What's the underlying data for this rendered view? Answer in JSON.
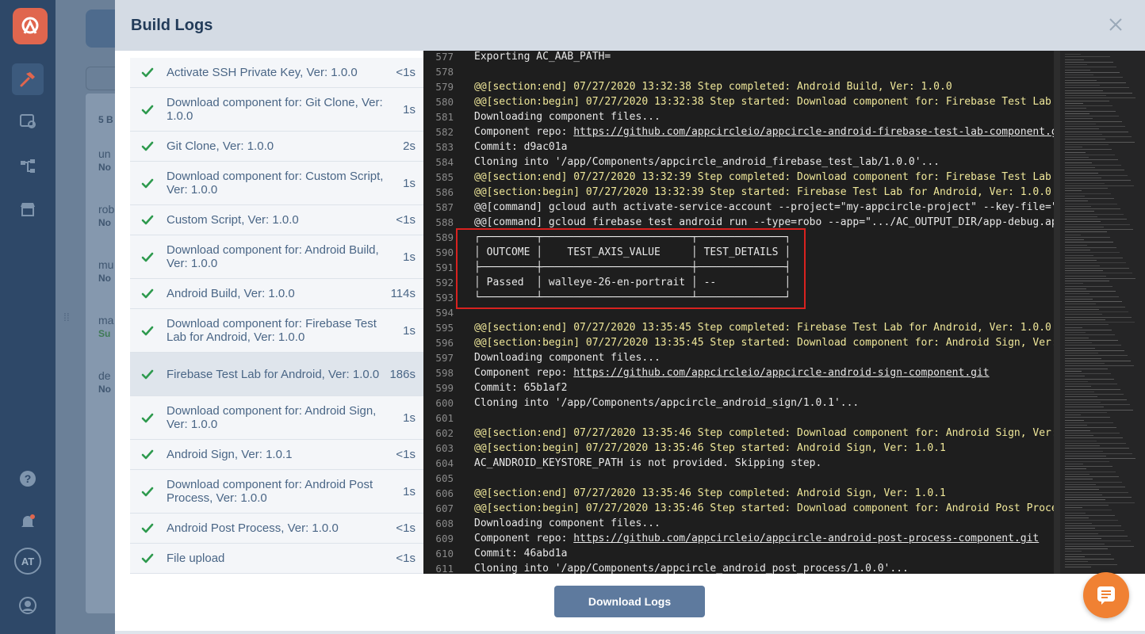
{
  "modal": {
    "title": "Build Logs",
    "download_label": "Download Logs"
  },
  "nav": {
    "avatar_initials": "AT"
  },
  "background": {
    "count_label": "5 B",
    "rows": [
      {
        "name": "un",
        "sub": "No"
      },
      {
        "name": "rob",
        "sub": "No"
      },
      {
        "name": "mu",
        "sub": "No"
      },
      {
        "name": "ma",
        "sub": "Su"
      },
      {
        "name": "de",
        "sub": "No"
      }
    ]
  },
  "steps": [
    {
      "label": "Activate SSH Private Key, Ver: 1.0.0",
      "duration": "<1s",
      "status": "success"
    },
    {
      "label": "Download component for: Git Clone, Ver: 1.0.0",
      "duration": "1s",
      "status": "success"
    },
    {
      "label": "Git Clone, Ver: 1.0.0",
      "duration": "2s",
      "status": "success"
    },
    {
      "label": "Download component for: Custom Script, Ver: 1.0.0",
      "duration": "1s",
      "status": "success"
    },
    {
      "label": "Custom Script, Ver: 1.0.0",
      "duration": "<1s",
      "status": "success"
    },
    {
      "label": "Download component for: Android Build, Ver: 1.0.0",
      "duration": "1s",
      "status": "success"
    },
    {
      "label": "Android Build, Ver: 1.0.0",
      "duration": "114s",
      "status": "success"
    },
    {
      "label": "Download component for: Firebase Test Lab for Android, Ver: 1.0.0",
      "duration": "1s",
      "status": "success"
    },
    {
      "label": "Firebase Test Lab for Android, Ver: 1.0.0",
      "duration": "186s",
      "status": "success",
      "selected": true
    },
    {
      "label": "Download component for: Android Sign, Ver: 1.0.0",
      "duration": "1s",
      "status": "success"
    },
    {
      "label": "Android Sign, Ver: 1.0.1",
      "duration": "<1s",
      "status": "success"
    },
    {
      "label": "Download component for: Android Post Process, Ver: 1.0.0",
      "duration": "1s",
      "status": "success"
    },
    {
      "label": "Android Post Process, Ver: 1.0.0",
      "duration": "<1s",
      "status": "success"
    },
    {
      "label": "File upload",
      "duration": "<1s",
      "status": "success"
    }
  ],
  "log_lines": [
    {
      "num": "577",
      "text": "Exporting AC_AAB_PATH="
    },
    {
      "num": "578",
      "text": ""
    },
    {
      "num": "579",
      "text": "@@[section:end] 07/27/2020 13:32:38 Step completed: Android Build, Ver: 1.0.0",
      "kind": "section"
    },
    {
      "num": "580",
      "text": "@@[section:begin] 07/27/2020 13:32:38 Step started: Download component for: Firebase Test Lab f",
      "kind": "section"
    },
    {
      "num": "581",
      "text": "Downloading component files..."
    },
    {
      "num": "582",
      "text": "Component repo: ",
      "link": "https://github.com/appcircleio/appcircle-android-firebase-test-lab-component.git"
    },
    {
      "num": "583",
      "text": "Commit: d9ac01a"
    },
    {
      "num": "584",
      "text": "Cloning into '/app/Components/appcircle_android_firebase_test_lab/1.0.0'..."
    },
    {
      "num": "585",
      "text": "@@[section:end] 07/27/2020 13:32:39 Step completed: Download component for: Firebase Test Lab f",
      "kind": "section"
    },
    {
      "num": "586",
      "text": "@@[section:begin] 07/27/2020 13:32:39 Step started: Firebase Test Lab for Android, Ver: 1.0.0",
      "kind": "section"
    },
    {
      "num": "587",
      "text": "@@[command] gcloud auth activate-service-account --project=\"my-appcircle-project\" --key-file=\"."
    },
    {
      "num": "588",
      "text": "@@[command] gcloud firebase test android run --type=robo --app=\".../AC_OUTPUT_DIR/app-debug.apk"
    },
    {
      "num": "589",
      "text": "┌─────────┬────────────────────────┬──────────────┐"
    },
    {
      "num": "590",
      "text": "│ OUTCOME │    TEST_AXIS_VALUE     │ TEST_DETAILS │"
    },
    {
      "num": "591",
      "text": "├─────────┼────────────────────────┼──────────────┤"
    },
    {
      "num": "592",
      "text": "│ Passed  │ walleye-26-en-portrait │ --           │"
    },
    {
      "num": "593",
      "text": "└─────────┴────────────────────────┴──────────────┘"
    },
    {
      "num": "594",
      "text": ""
    },
    {
      "num": "595",
      "text": "@@[section:end] 07/27/2020 13:35:45 Step completed: Firebase Test Lab for Android, Ver: 1.0.0",
      "kind": "section"
    },
    {
      "num": "596",
      "text": "@@[section:begin] 07/27/2020 13:35:45 Step started: Download component for: Android Sign, Ver:",
      "kind": "section"
    },
    {
      "num": "597",
      "text": "Downloading component files..."
    },
    {
      "num": "598",
      "text": "Component repo: ",
      "link": "https://github.com/appcircleio/appcircle-android-sign-component.git"
    },
    {
      "num": "599",
      "text": "Commit: 65b1af2"
    },
    {
      "num": "600",
      "text": "Cloning into '/app/Components/appcircle_android_sign/1.0.1'..."
    },
    {
      "num": "601",
      "text": ""
    },
    {
      "num": "602",
      "text": "@@[section:end] 07/27/2020 13:35:46 Step completed: Download component for: Android Sign, Ver:",
      "kind": "section"
    },
    {
      "num": "603",
      "text": "@@[section:begin] 07/27/2020 13:35:46 Step started: Android Sign, Ver: 1.0.1",
      "kind": "section"
    },
    {
      "num": "604",
      "text": "AC_ANDROID_KEYSTORE_PATH is not provided. Skipping step."
    },
    {
      "num": "605",
      "text": ""
    },
    {
      "num": "606",
      "text": "@@[section:end] 07/27/2020 13:35:46 Step completed: Android Sign, Ver: 1.0.1",
      "kind": "section"
    },
    {
      "num": "607",
      "text": "@@[section:begin] 07/27/2020 13:35:46 Step started: Download component for: Android Post Proces",
      "kind": "section"
    },
    {
      "num": "608",
      "text": "Downloading component files..."
    },
    {
      "num": "609",
      "text": "Component repo: ",
      "link": "https://github.com/appcircleio/appcircle-android-post-process-component.git"
    },
    {
      "num": "610",
      "text": "Commit: 46abd1a"
    },
    {
      "num": "611",
      "text": "Cloning into '/app/Components/appcircle_android_post_process/1.0.0'..."
    }
  ],
  "colors": {
    "success_check": "#2e9a4e",
    "log_background": "#1e1e1e",
    "section_text": "#f0e89a",
    "highlight_border": "#d9221f",
    "download_button": "#5e7a9e",
    "chat_button": "#f08133"
  },
  "icons": {
    "close": "close-icon",
    "check": "check-icon",
    "chat": "chat-icon"
  }
}
